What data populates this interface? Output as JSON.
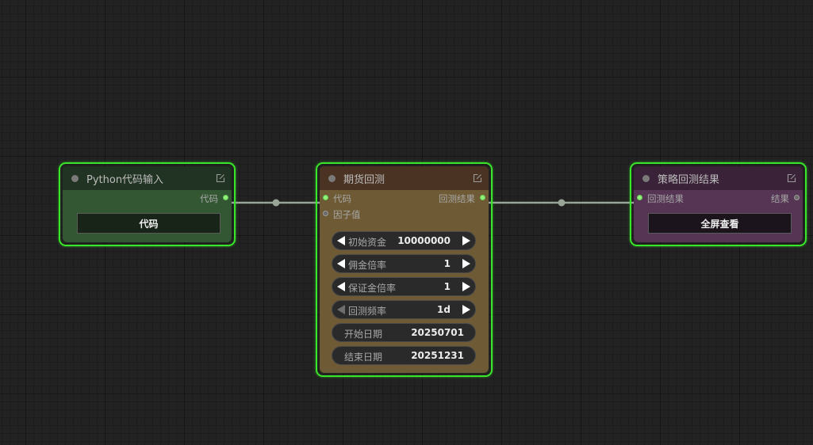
{
  "nodes": {
    "python_input": {
      "title": "Python代码输入",
      "output_label": "代码",
      "button_label": "代码"
    },
    "futures_backtest": {
      "title": "期货回测",
      "inputs": [
        "代码",
        "因子值"
      ],
      "output_label": "回测结果",
      "widgets": [
        {
          "label": "初始资金",
          "value": "10000000"
        },
        {
          "label": "佣金倍率",
          "value": "1"
        },
        {
          "label": "保证金倍率",
          "value": "1"
        },
        {
          "label": "回测频率",
          "value": "1d"
        },
        {
          "label": "开始日期",
          "value": "20250701"
        },
        {
          "label": "结束日期",
          "value": "20251231"
        }
      ]
    },
    "strategy_result": {
      "title": "策略回测结果",
      "input_label": "回测结果",
      "output_label": "结果",
      "button_label": "全屏查看"
    }
  },
  "icons": {
    "edit": "edit-icon",
    "left_arrow": "arrow-left-icon",
    "right_arrow": "arrow-right-icon"
  },
  "colors": {
    "canvas_bg": "#222222",
    "selection_border": "#39e62a",
    "link": "#9aa59a",
    "python_title_bg": "#213322",
    "python_body_bg": "#335733",
    "backtest_title_bg": "#4a3322",
    "backtest_body_bg": "#6e5a34",
    "result_title_bg": "#3a2238",
    "result_body_bg": "#553553"
  }
}
